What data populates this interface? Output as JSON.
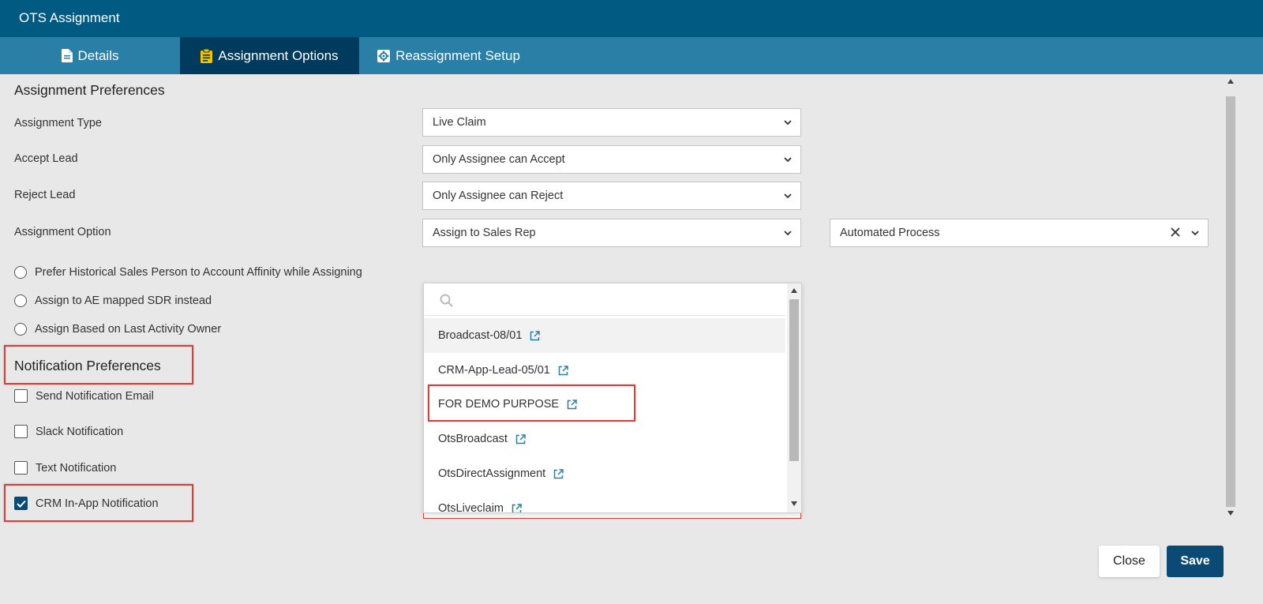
{
  "window": {
    "title": "OTS Assignment"
  },
  "tabs": [
    {
      "label": "Details",
      "icon": "document-icon"
    },
    {
      "label": "Assignment Options",
      "icon": "clipboard-icon"
    },
    {
      "label": "Reassignment Setup",
      "icon": "gear-icon"
    }
  ],
  "active_tab": "Assignment Options",
  "assignment_preferences": {
    "heading": "Assignment Preferences",
    "rows": [
      {
        "label": "Assignment Type",
        "value": "Live Claim"
      },
      {
        "label": "Accept Lead",
        "value": "Only Assignee can Accept"
      },
      {
        "label": "Reject Lead",
        "value": "Only Assignee can Reject"
      },
      {
        "label": "Assignment Option",
        "value": "Assign to Sales Rep",
        "secondary_value": "Automated Process"
      }
    ],
    "radios": [
      "Prefer Historical Sales Person to Account Affinity while Assigning",
      "Assign to AE mapped SDR instead",
      "Assign Based on Last Activity Owner"
    ]
  },
  "notification_preferences": {
    "heading": "Notification Preferences",
    "checkboxes": [
      {
        "label": "Send Notification Email",
        "checked": false
      },
      {
        "label": "Slack Notification",
        "checked": false
      },
      {
        "label": "Text Notification",
        "checked": false
      },
      {
        "label": "CRM In-App Notification",
        "checked": true
      }
    ]
  },
  "dropdown": {
    "search_placeholder": "",
    "items": [
      "Broadcast-08/01",
      "CRM-App-Lead-05/01",
      "FOR DEMO PURPOSE",
      "OtsBroadcast",
      "OtsDirectAssignment",
      "OtsLiveclaim"
    ]
  },
  "footer": {
    "close_label": "Close",
    "save_label": "Save"
  },
  "colors": {
    "header": "#005a82",
    "tabbar": "#2a7fa6",
    "active_tab": "#003a5c",
    "primary_button": "#0b4a75",
    "highlight": "#e03c3c",
    "link_icon": "#2a7fa6"
  }
}
